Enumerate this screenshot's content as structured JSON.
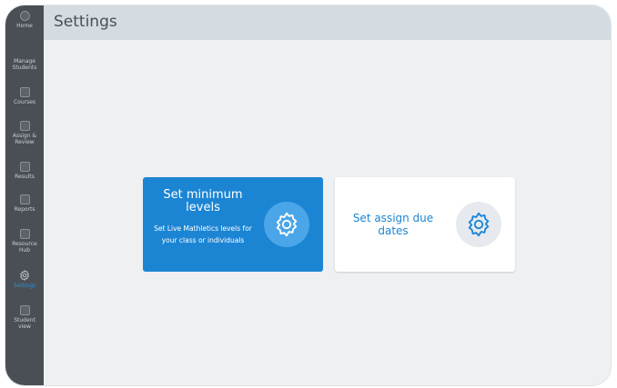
{
  "sidebar": {
    "items": [
      {
        "label": "Home",
        "icon": "home-icon"
      },
      {
        "label": "Manage\nStudents",
        "icon": "people-icon"
      },
      {
        "label": "Courses",
        "icon": "courses-icon"
      },
      {
        "label": "Assign &\nReview",
        "icon": "assign-icon"
      },
      {
        "label": "Results",
        "icon": "results-icon"
      },
      {
        "label": "Reports",
        "icon": "reports-icon"
      },
      {
        "label": "Resource\nHub",
        "icon": "resource-hub-icon"
      },
      {
        "label": "Settings",
        "icon": "gear-icon"
      },
      {
        "label": "Student\nview",
        "icon": "student-view-icon"
      }
    ]
  },
  "header": {
    "title": "Settings"
  },
  "cards": [
    {
      "title": "Set minimum levels",
      "description": "Set Live Mathletics levels for your class or individuals",
      "icon": "gear-icon"
    },
    {
      "title": "Set assign due dates",
      "icon": "gear-icon"
    }
  ],
  "colors": {
    "accent": "#1c85d3",
    "sidebar": "#4a4f55",
    "header": "#d4dbe1",
    "background": "#eef0f2"
  }
}
